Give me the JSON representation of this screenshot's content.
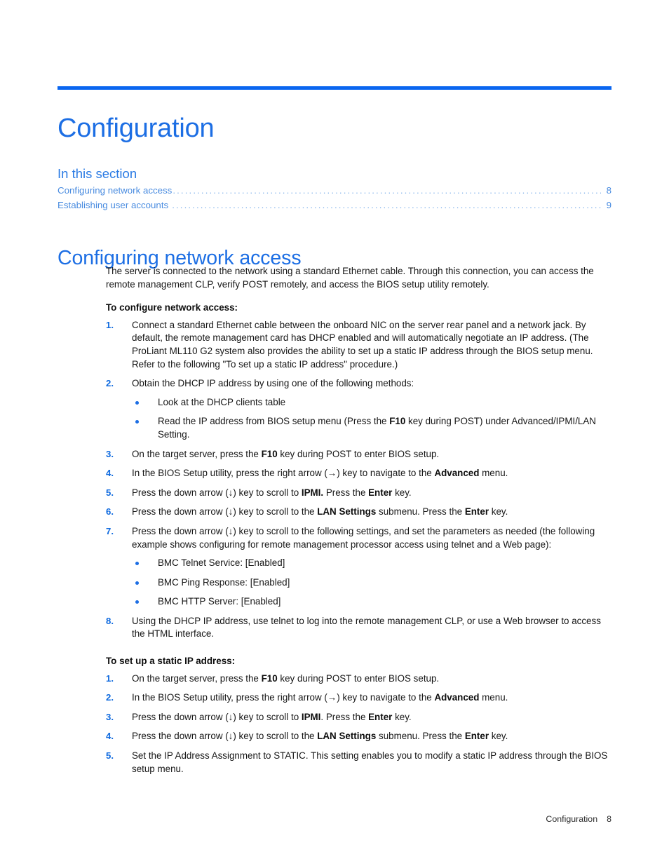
{
  "document": {
    "chapter_title": "Configuration",
    "accent_color": "#1C6EE4",
    "rule_color": "#0A66F0"
  },
  "toc": {
    "heading": "In this section",
    "entries": [
      {
        "label": "Configuring network access",
        "page": "8"
      },
      {
        "label": "Establishing user accounts",
        "page": "9"
      }
    ]
  },
  "section": {
    "heading": "Configuring network access",
    "intro": "The server is connected to the network using a standard Ethernet cable. Through this connection, you can access the remote management CLP, verify POST remotely, and access the BIOS setup utility remotely."
  },
  "procedure_a": {
    "heading": "To configure network access:",
    "steps": [
      {
        "num": "1.",
        "parts": [
          {
            "t": "Connect a standard Ethernet cable between the onboard NIC on the server rear panel and a network jack. By default, the remote management card has DHCP enabled and will automatically negotiate an IP address. (The ProLiant ML110 G2 system also provides the ability to set up a static IP address through the BIOS setup menu. Refer to the following \"To set up a static IP address\" procedure.)",
            "b": false
          }
        ]
      },
      {
        "num": "2.",
        "parts": [
          {
            "t": "Obtain the DHCP IP address by using one of the following methods:",
            "b": false
          }
        ],
        "bullets": [
          [
            {
              "t": "Look at the DHCP clients table",
              "b": false
            }
          ],
          [
            {
              "t": "Read the IP address from BIOS setup menu (Press the ",
              "b": false
            },
            {
              "t": "F10",
              "b": true
            },
            {
              "t": " key during POST) under Advanced/IPMI/LAN Setting.",
              "b": false
            }
          ]
        ]
      },
      {
        "num": "3.",
        "parts": [
          {
            "t": "On the target server, press the ",
            "b": false
          },
          {
            "t": "F10",
            "b": true
          },
          {
            "t": " key during POST to enter BIOS setup.",
            "b": false
          }
        ]
      },
      {
        "num": "4.",
        "parts": [
          {
            "t": "In the BIOS Setup utility, press the right arrow (→) key to navigate to the ",
            "b": false
          },
          {
            "t": "Advanced",
            "b": true
          },
          {
            "t": " menu.",
            "b": false
          }
        ]
      },
      {
        "num": "5.",
        "parts": [
          {
            "t": "Press the down arrow (↓) key to scroll to ",
            "b": false
          },
          {
            "t": "IPMI.",
            "b": true
          },
          {
            "t": " Press the ",
            "b": false
          },
          {
            "t": "Enter",
            "b": true
          },
          {
            "t": " key.",
            "b": false
          }
        ]
      },
      {
        "num": "6.",
        "parts": [
          {
            "t": "Press the down arrow (↓) key to scroll to the ",
            "b": false
          },
          {
            "t": "LAN Settings",
            "b": true
          },
          {
            "t": " submenu. Press the ",
            "b": false
          },
          {
            "t": "Enter",
            "b": true
          },
          {
            "t": " key.",
            "b": false
          }
        ]
      },
      {
        "num": "7.",
        "parts": [
          {
            "t": "Press the down arrow (↓) key to scroll to the following settings, and set the parameters as needed (the following example shows configuring for remote management processor access using telnet and a Web page):",
            "b": false
          }
        ],
        "bullets": [
          [
            {
              "t": "BMC Telnet Service: [Enabled]",
              "b": false
            }
          ],
          [
            {
              "t": "BMC Ping Response: [Enabled]",
              "b": false
            }
          ],
          [
            {
              "t": "BMC HTTP Server: [Enabled]",
              "b": false
            }
          ]
        ]
      },
      {
        "num": "8.",
        "parts": [
          {
            "t": "Using the DHCP IP address, use telnet to log into the remote management CLP, or use a Web browser to access the HTML interface.",
            "b": false
          }
        ]
      }
    ]
  },
  "procedure_b": {
    "heading": "To set up a static IP address:",
    "steps": [
      {
        "num": "1.",
        "parts": [
          {
            "t": "On the target server, press the ",
            "b": false
          },
          {
            "t": "F10",
            "b": true
          },
          {
            "t": " key during POST to enter BIOS setup.",
            "b": false
          }
        ]
      },
      {
        "num": "2.",
        "parts": [
          {
            "t": "In the BIOS Setup utility, press the right arrow (→) key to navigate to the ",
            "b": false
          },
          {
            "t": "Advanced",
            "b": true
          },
          {
            "t": " menu.",
            "b": false
          }
        ]
      },
      {
        "num": "3.",
        "parts": [
          {
            "t": "Press the down arrow (↓) key to scroll to ",
            "b": false
          },
          {
            "t": "IPMI",
            "b": true
          },
          {
            "t": ". Press the ",
            "b": false
          },
          {
            "t": "Enter",
            "b": true
          },
          {
            "t": " key.",
            "b": false
          }
        ]
      },
      {
        "num": "4.",
        "parts": [
          {
            "t": "Press the down arrow (↓) key to scroll to the ",
            "b": false
          },
          {
            "t": "LAN Settings",
            "b": true
          },
          {
            "t": " submenu. Press the ",
            "b": false
          },
          {
            "t": "Enter",
            "b": true
          },
          {
            "t": " key.",
            "b": false
          }
        ]
      },
      {
        "num": "5.",
        "parts": [
          {
            "t": "Set the IP Address Assignment to STATIC. This setting enables you to modify a static IP address through the BIOS setup menu.",
            "b": false
          }
        ]
      }
    ]
  },
  "footer": {
    "label": "Configuration",
    "page": "8"
  }
}
